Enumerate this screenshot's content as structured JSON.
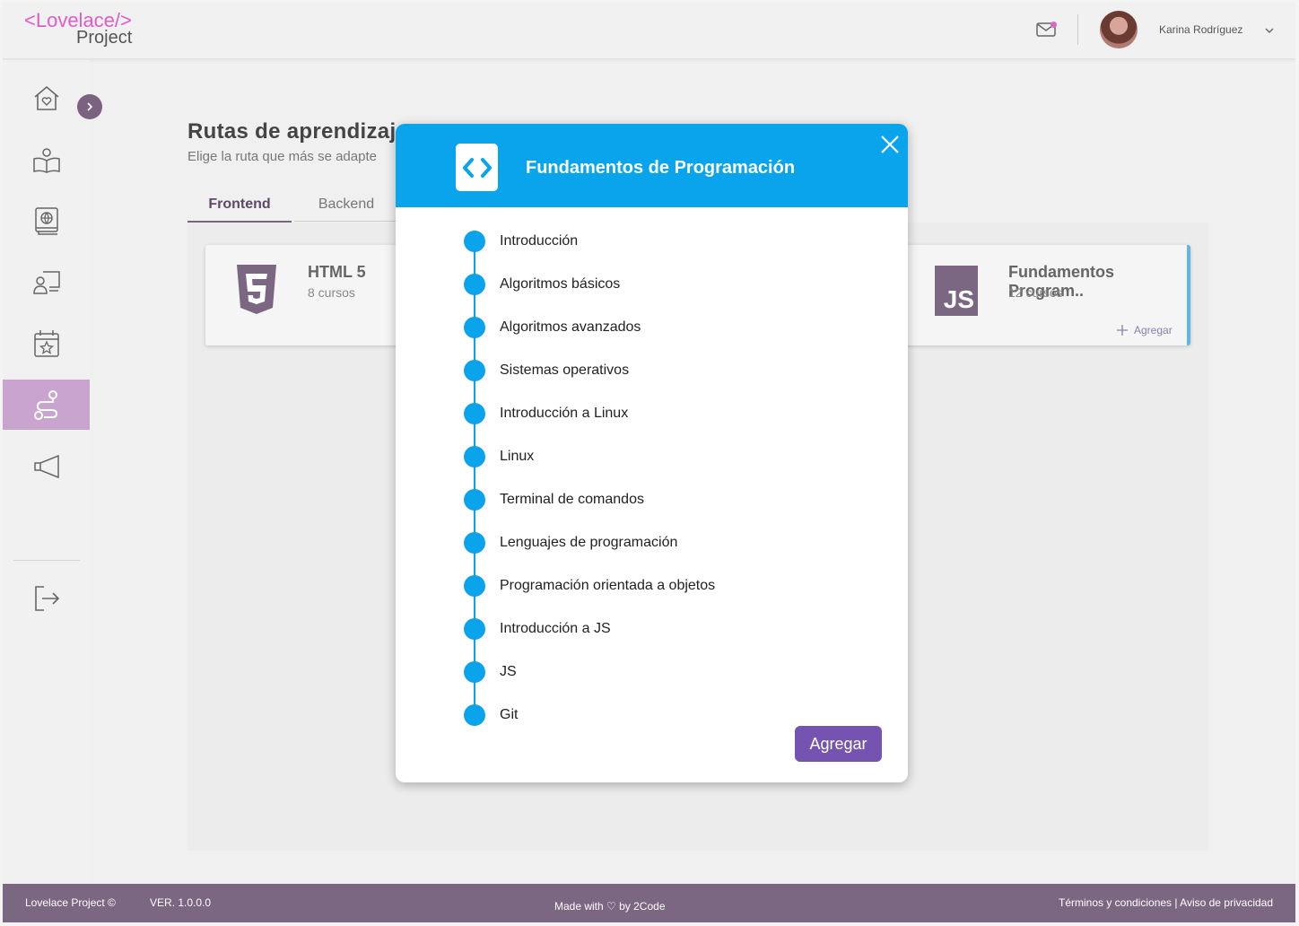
{
  "header": {
    "logo_line1": "<Lovelace/>",
    "logo_line2": "Project",
    "user_name": "Karina Rodríguez"
  },
  "sidebar": {
    "items": [
      "home-heart-icon",
      "open-book-user-icon",
      "globe-book-icon",
      "teacher-board-icon",
      "calendar-star-icon",
      "route-icon",
      "megaphone-icon"
    ],
    "active": "route-icon",
    "logout": "logout-icon"
  },
  "main": {
    "title": "Rutas de aprendizaje",
    "subtitle": "Elige la ruta que más se adapte",
    "tabs": [
      {
        "label": "Frontend",
        "active": true
      },
      {
        "label": "Backend",
        "active": false
      }
    ],
    "cards": [
      {
        "title": "HTML 5",
        "subtitle": "8 cursos",
        "icon": "html5-icon"
      },
      {
        "title": "Fundamentos Program..",
        "subtitle": "12 cursos",
        "icon": "js-icon",
        "add_label": "Agregar"
      }
    ]
  },
  "modal": {
    "title": "Fundamentos de Programación",
    "icon": "code-icon",
    "steps": [
      "Introducción",
      "Algoritmos básicos",
      "Algoritmos avanzados",
      "Sistemas operativos",
      "Introducción a Linux",
      "Linux",
      "Terminal de comandos",
      "Lenguajes de programación",
      "Programación orientada a objetos",
      "Introducción a JS",
      "JS",
      "Git"
    ],
    "button_label": "Agregar"
  },
  "footer": {
    "copyright": "Lovelace Project ©",
    "version": "VER. 1.0.0.0",
    "made_with": "Made with ♡ by 2Code",
    "links": "Términos y condiciones | Aviso de privacidad"
  },
  "colors": {
    "accent": "#0aa4ec",
    "brand_purple": "#7b6782",
    "button": "#7454b0",
    "logo_pink": "#e05cc7"
  }
}
